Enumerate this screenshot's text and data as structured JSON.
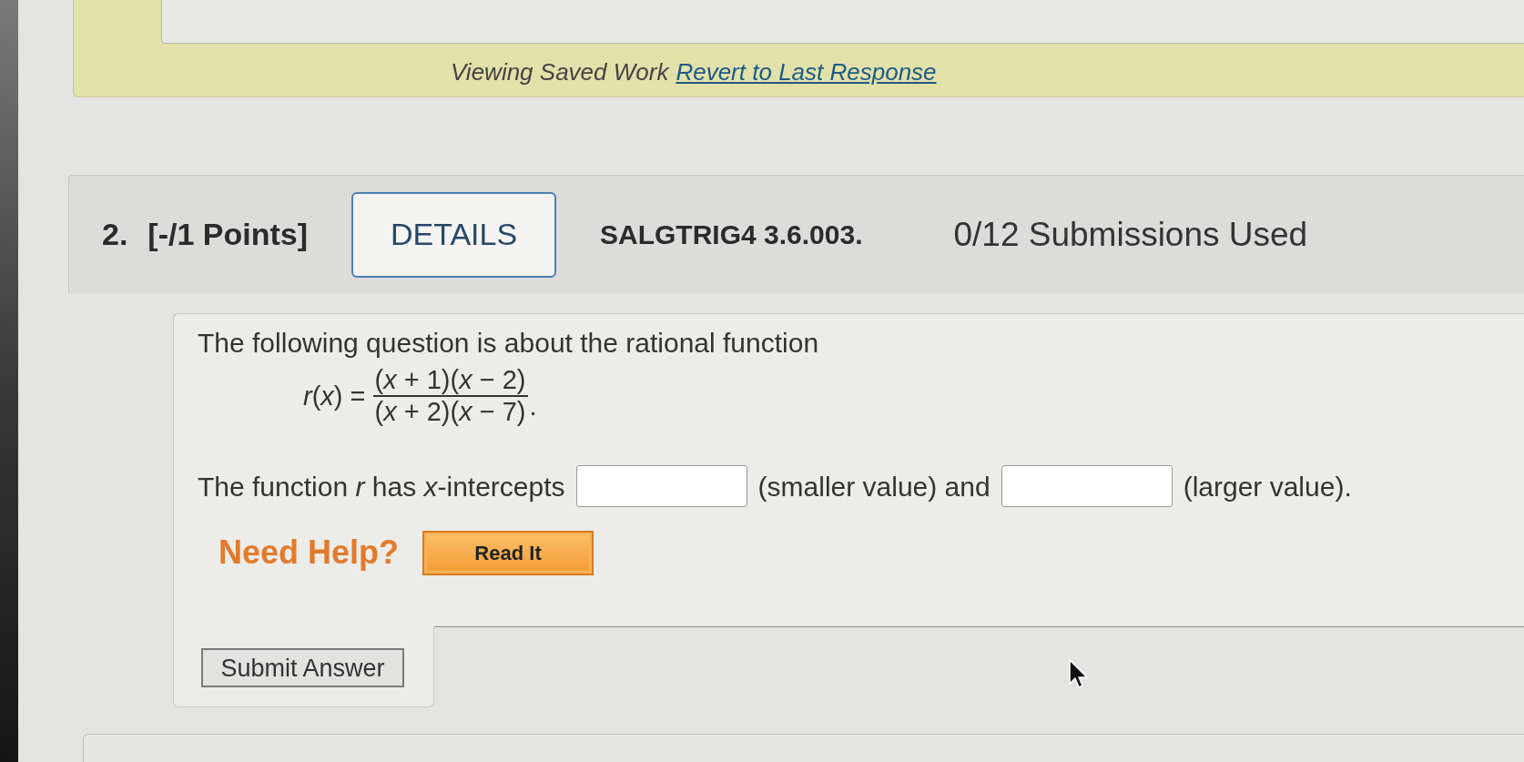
{
  "banner": {
    "status": "Viewing Saved Work",
    "link": "Revert to Last Response"
  },
  "question_header": {
    "number": "2.",
    "points": "[-/1 Points]",
    "details_button": "DETAILS",
    "problem_id": "SALGTRIG4 3.6.003.",
    "submissions": "0/12 Submissions Used"
  },
  "question": {
    "intro": "The following question is about the rational function",
    "formula": {
      "lhs": "*r*(*x*) =",
      "numerator": "(*x* + 1)(*x* − 2)",
      "denominator": "(*x* + 2)(*x* − 7)",
      "end": "."
    },
    "prompt_parts": [
      {
        "kind": "text",
        "text": "The function *r* has *x*-intercepts"
      },
      {
        "kind": "blank"
      },
      {
        "kind": "text",
        "text": "(smaller value) and"
      },
      {
        "kind": "blank"
      },
      {
        "kind": "text",
        "text": "(larger value)."
      }
    ],
    "help": {
      "label": "Need Help?",
      "buttons": [
        "Read It"
      ]
    },
    "submit_button": "Submit Answer"
  }
}
